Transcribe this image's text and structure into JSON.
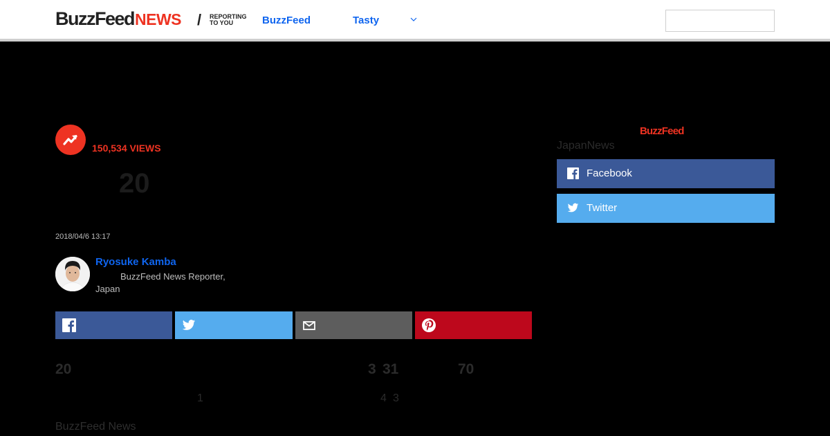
{
  "header": {
    "logo_main": "BuzzFeed",
    "logo_news": "NEWS",
    "logo_tag_line1": "REPORTING",
    "logo_tag_line2": "TO YOU",
    "nav": [
      "BuzzFeed",
      "Tasty"
    ],
    "accent": "#0f65ef"
  },
  "article": {
    "views": "150,534 VIEWS",
    "title_number": "20",
    "date": "2018/04/6 13:17",
    "author_name": "Ryosuke Kamba",
    "author_role": "BuzzFeed News Reporter,",
    "author_region": "Japan"
  },
  "share": {
    "facebook_color": "#3b5998",
    "twitter_color": "#55acee",
    "email_color": "#5d5d5d",
    "pinterest_color": "#bd081c"
  },
  "body_fragments": {
    "line1": [
      "20",
      "3",
      "31",
      "70"
    ],
    "line2": [
      "1",
      "4",
      "3"
    ],
    "brand": "BuzzFeed News"
  },
  "sidebar": {
    "logo": "BuzzFeed",
    "label": "JapanNews",
    "facebook": "Facebook",
    "twitter": "Twitter"
  },
  "colors": {
    "brand_red": "#ee3322",
    "background": "#000000"
  }
}
